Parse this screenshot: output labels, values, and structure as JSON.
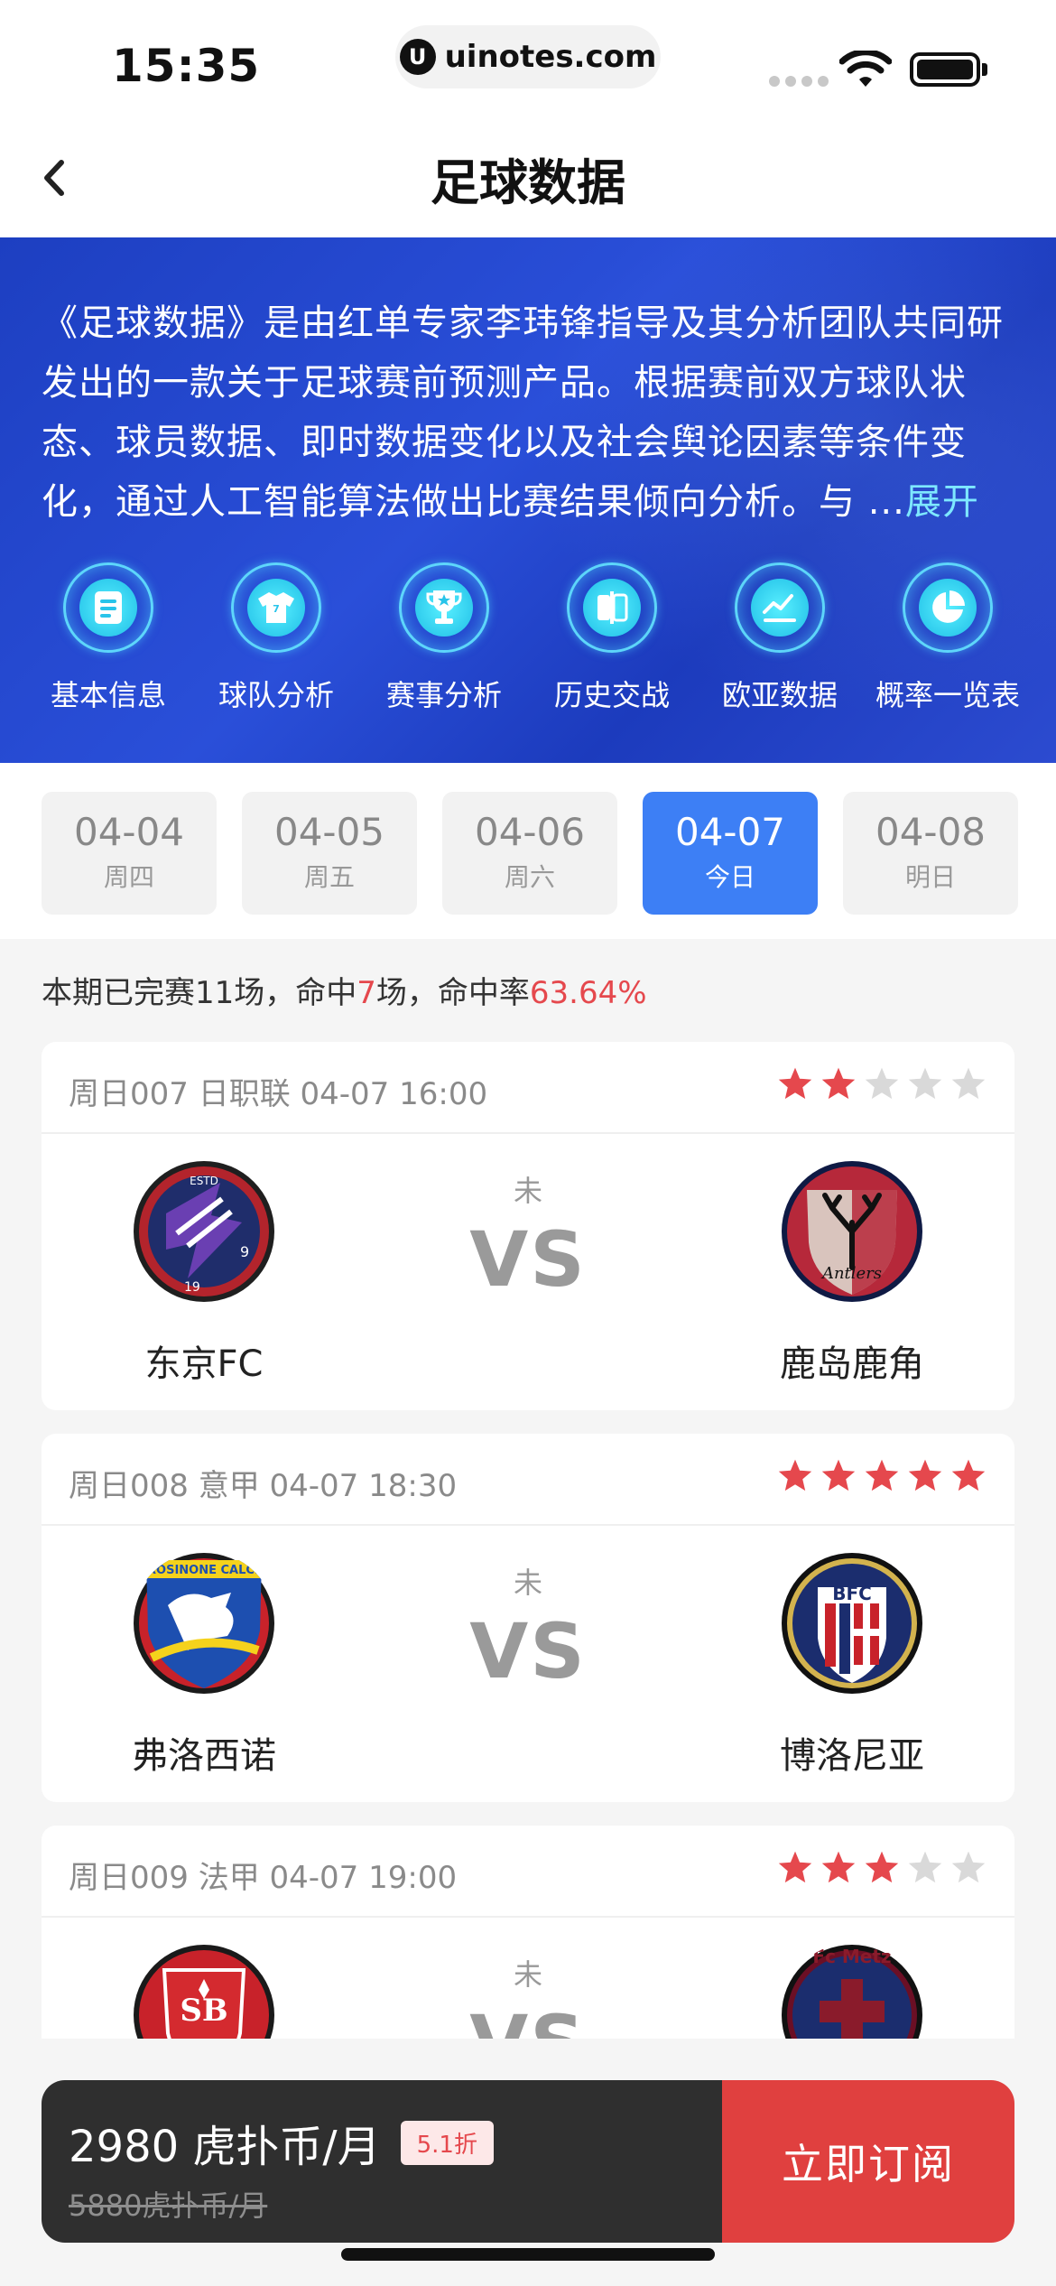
{
  "status_bar": {
    "time": "15:35",
    "url": "uinotes.com"
  },
  "nav": {
    "title": "足球数据",
    "back_icon": "chevron-left-icon"
  },
  "banner": {
    "intro": "《足球数据》是由红单专家李玮锋指导及其分析团队共同研发出的一款关于足球赛前预测产品。根据赛前双方球队状态、球员数据、即时数据变化以及社会舆论因素等条件变化，通过人工智能算法做出比赛结果倾向分析。与 ...",
    "more_label": "展开",
    "features": [
      {
        "label": "基本信息",
        "icon": "document-icon"
      },
      {
        "label": "球队分析",
        "icon": "jersey-icon"
      },
      {
        "label": "赛事分析",
        "icon": "trophy-icon"
      },
      {
        "label": "历史交战",
        "icon": "split-icon"
      },
      {
        "label": "欧亚数据",
        "icon": "chart-line-icon"
      },
      {
        "label": "概率一览表",
        "icon": "pie-chart-icon"
      }
    ]
  },
  "dates": [
    {
      "date": "04-04",
      "weekday": "周四",
      "active": false
    },
    {
      "date": "04-05",
      "weekday": "周五",
      "active": false
    },
    {
      "date": "04-06",
      "weekday": "周六",
      "active": false
    },
    {
      "date": "04-07",
      "weekday": "今日",
      "active": true
    },
    {
      "date": "04-08",
      "weekday": "明日",
      "active": false
    }
  ],
  "summary": {
    "prefix": "本期已完赛11场，命中",
    "hits": "7",
    "mid": "场，命中率",
    "rate": "63.64%"
  },
  "matches": [
    {
      "meta": "周日007 日职联 04-07 16:00",
      "stars": 2,
      "status": "未",
      "vs": "VS",
      "home": "东京FC",
      "away": "鹿岛鹿角"
    },
    {
      "meta": "周日008 意甲 04-07 18:30",
      "stars": 5,
      "status": "未",
      "vs": "VS",
      "home": "弗洛西诺",
      "away": "博洛尼亚"
    },
    {
      "meta": "周日009 法甲 04-07 19:00",
      "stars": 3,
      "status": "未",
      "vs": "VS",
      "home": "",
      "away": ""
    }
  ],
  "subscribe": {
    "price": "2980 虎扑币/月",
    "discount": "5.1折",
    "original": "5880虎扑币/月",
    "button": "立即订阅"
  },
  "colors": {
    "accent_blue": "#3d7ff5",
    "banner_blue": "#2a4fd9",
    "red": "#e5484d",
    "star_red": "#e5484d",
    "star_gray": "#d9d9d9"
  }
}
